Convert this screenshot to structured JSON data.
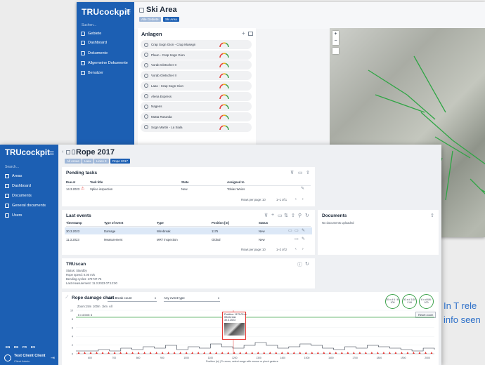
{
  "back": {
    "logo": "TRUcockpit",
    "search": "Suchen...",
    "nav": [
      "Gebiete",
      "Dashboard",
      "Dokumente",
      "Allgemeine Dokumente",
      "Benutzer"
    ],
    "title": "Ski Area",
    "breadcrumb": [
      "Alle Gebiete",
      "Ski Area"
    ],
    "anlagen_title": "Anlagen",
    "anlagen": [
      "Crap Sogn Gion - Crap Masegn",
      "Plaun - Crap Sogn Gion",
      "Vorab Gletscher II",
      "Vorab Gletscher II",
      "Laax - Crap Sogn Gion",
      "Alena Express",
      "Nagens",
      "Mutta Rotunda",
      "Sogn Martin - La Siala"
    ]
  },
  "front": {
    "logo": "TRUcockpit",
    "search": "Search...",
    "nav": [
      "Areas",
      "Dashboard",
      "Documents",
      "General documents",
      "Users"
    ],
    "title": "Rope 2017",
    "breadcrumb": [
      "All Areas",
      "Laax",
      "Lines 3",
      "Rope 2017"
    ],
    "languages": [
      "EN",
      "DE",
      "FR",
      "ES"
    ],
    "user_name": "Test Client Client",
    "user_role": "Client Admin",
    "pending": {
      "title": "Pending tasks",
      "headers": [
        "Due at",
        "Task title",
        "State",
        "Assigned to"
      ],
      "rows": [
        [
          "14.3.2023",
          "Splice inspection",
          "New",
          "Tobias Weiss"
        ]
      ],
      "rows_per_page": "Rows per page:",
      "rpp_value": "10",
      "range": "1–1 of 1"
    },
    "events": {
      "title": "Last events",
      "headers": [
        "Timestamp",
        "Type of event",
        "Type",
        "Position [m]",
        "Status"
      ],
      "rows": [
        [
          "30.3.2023",
          "Damage",
          "Wirebreak",
          "1175",
          "New"
        ],
        [
          "11.3.2023",
          "Measurement",
          "MRT inspection",
          "Global",
          "New"
        ]
      ],
      "rows_per_page": "Rows per page:",
      "rpp_value": "10",
      "range": "1–2 of 2"
    },
    "documents": {
      "title": "Documents",
      "empty": "No documents uploaded"
    },
    "truscan": {
      "title": "TRUscan",
      "status": "Status: Standby",
      "speed": "Rope speed: 0.00 m/s",
      "cycles": "Bending cycles: 174747.75",
      "last": "Last measurement: 11.3.2023 07:12:00"
    },
    "chart": {
      "title": "Rope damage chart",
      "select1": "Wire Break count",
      "select2": "Any event type",
      "zoom_label": "Zoom:",
      "zooms": [
        "15m",
        "100m",
        "1km",
        "All"
      ],
      "reset": "Reset zoom",
      "limit_label": "6 x d limit: 6",
      "tooltip_pos": "Position: 1175.00 m",
      "tooltip_type": "Wirebreak",
      "tooltip_date": "30.3.2023",
      "footer": "Position [m] | To zoom, select range with mouse or pinch gesture",
      "y_ticks": [
        "10",
        "8",
        "6",
        "4",
        "2",
        "0"
      ],
      "x_ticks": [
        "600",
        "700",
        "800",
        "900",
        "1000",
        "1100",
        "1200",
        "1300",
        "1400",
        "1500",
        "1600",
        "1700",
        "1800",
        "1900",
        "2000"
      ],
      "circles": [
        "30 x d 6 / 6: 100",
        "30 x d 1/10 / 1/6",
        "6 x d 6/6: 100"
      ]
    }
  },
  "side_text": "In T rele info seen",
  "colors": {
    "brand_blue": "#1c5fb3",
    "accent_green": "#3fa34d",
    "danger_red": "#e53935"
  }
}
